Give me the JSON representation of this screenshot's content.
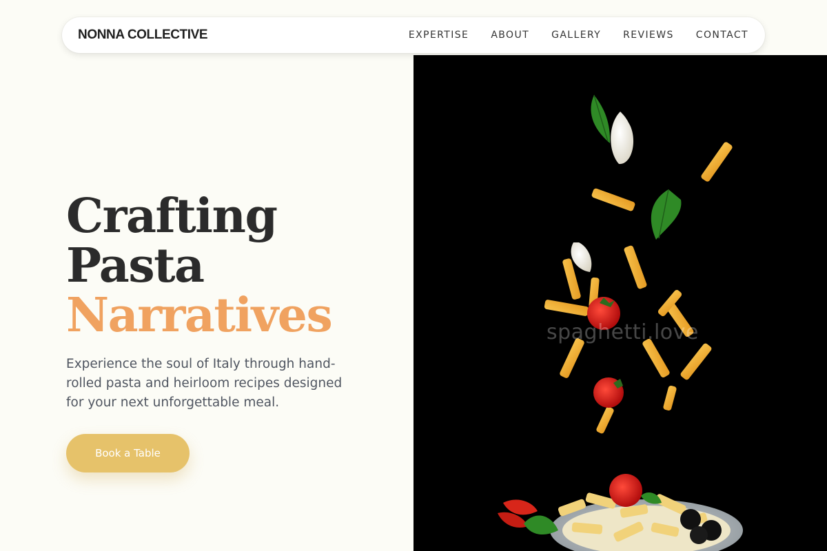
{
  "nav": {
    "brand": "NONNA COLLECTIVE",
    "links": [
      "EXPERTISE",
      "ABOUT",
      "GALLERY",
      "REVIEWS",
      "CONTACT"
    ]
  },
  "hero": {
    "headline_line1": "Crafting",
    "headline_line2": "Pasta",
    "headline_accent": "Narratives",
    "lede": "Experience the soul of Italy through hand-rolled pasta and heirloom recipes designed for your next unforgettable meal.",
    "cta_label": "Book a Table"
  },
  "image": {
    "watermark": "spaghetti.love",
    "subject": "falling penne pasta, garlic, basil, tomatoes over a plate"
  },
  "colors": {
    "background": "#fcfcf6",
    "accent": "#f0a260",
    "button": "#e6c26a",
    "heading": "#2b2b2b"
  }
}
